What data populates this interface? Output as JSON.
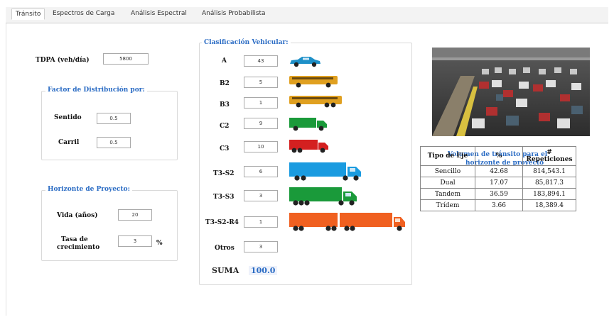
{
  "tabs": [
    "Tránsito",
    "Espectros de Carga",
    "Análisis Espectral",
    "Análisis Probabilista"
  ],
  "tdpa": {
    "label": "TDPA (veh/día)",
    "value": "5800"
  },
  "factor": {
    "title": "Factor de Distribución por:",
    "sentido": {
      "label": "Sentido",
      "value": "0.5"
    },
    "carril": {
      "label": "Carril",
      "value": "0.5"
    }
  },
  "horizonte": {
    "title": "Horizonte de Proyecto:",
    "vida": {
      "label": "Vida (años)",
      "value": "20"
    },
    "tasa": {
      "label_line1": "Tasa de",
      "label_line2": "crecimiento",
      "value": "3",
      "unit": "%"
    }
  },
  "clasificacion": {
    "title": "Clasificación Vehicular:",
    "rows": [
      {
        "label": "A",
        "value": "43"
      },
      {
        "label": "B2",
        "value": "5"
      },
      {
        "label": "B3",
        "value": "1"
      },
      {
        "label": "C2",
        "value": "9"
      },
      {
        "label": "C3",
        "value": "10"
      },
      {
        "label": "T3-S2",
        "value": "6"
      },
      {
        "label": "T3-S3",
        "value": "3"
      },
      {
        "label": "T3-S2-R4",
        "value": "1"
      },
      {
        "label": "Otros",
        "value": "3"
      }
    ],
    "suma_label": "SUMA",
    "suma_value": "100.0"
  },
  "volumen": {
    "title_line1": "Volumen de tránsito para el",
    "title_line2": "horizonte de proyecto",
    "headers": [
      "Tipo de Eje",
      "%",
      "# Repeticiones"
    ],
    "rows": [
      [
        "Sencillo",
        "42.68",
        "814,543.1"
      ],
      [
        "Dual",
        "17.07",
        "85,817.3"
      ],
      [
        "Tandem",
        "36.59",
        "183,894.1"
      ],
      [
        "Trídem",
        "3.66",
        "18,389.4"
      ]
    ]
  },
  "colors": {
    "accent": "#2b6cc4",
    "car": "#1e90c8",
    "bus": "#e0a020",
    "truck_green": "#1a9a3a",
    "truck_red": "#d42020",
    "trailer_blue": "#1a9be0",
    "trailer_orange": "#f06020"
  }
}
